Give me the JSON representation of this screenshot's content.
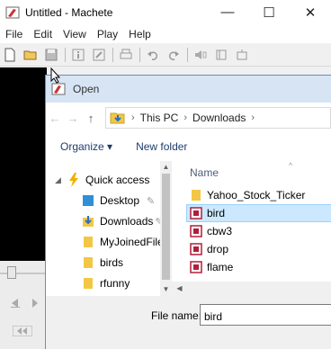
{
  "app": {
    "title": "Untitled - Machete",
    "minimize_glyph": "—",
    "maximize_glyph": "☐",
    "close_glyph": "✕"
  },
  "menu": [
    "File",
    "Edit",
    "View",
    "Play",
    "Help"
  ],
  "toolbar": {
    "icons": [
      "new-file-icon",
      "open-folder-icon",
      "save-icon",
      "info-icon",
      "edit-tags-icon",
      "print-icon",
      "undo-icon",
      "redo-icon",
      "speaker-icon",
      "mark-in-icon",
      "mark-out-icon"
    ]
  },
  "dialog": {
    "title": "Open",
    "nav": {
      "back": "←",
      "forward": "→",
      "up": "↑"
    },
    "breadcrumb": [
      "This PC",
      "Downloads"
    ],
    "commands": {
      "organize": "Organize ▾",
      "new_folder": "New folder"
    },
    "nav_pane": {
      "quick_access": "Quick access",
      "items": [
        "Desktop",
        "Downloads",
        "MyJoinedFiles",
        "birds",
        "rfunny"
      ]
    },
    "files": {
      "column_name": "Name",
      "rows": [
        {
          "name": "Yahoo_Stock_Ticker",
          "type": "folder"
        },
        {
          "name": "bird",
          "type": "media"
        },
        {
          "name": "cbw3",
          "type": "media"
        },
        {
          "name": "drop",
          "type": "media"
        },
        {
          "name": "flame",
          "type": "media"
        }
      ],
      "selected_index": 1
    },
    "file_name_label": "File name:",
    "file_name_value": "bird"
  },
  "colors": {
    "accent": "#cce8ff",
    "folder": "#f3c744",
    "media_icon": "#b01e3a",
    "dialog_title_bg": "#d6e4f4"
  }
}
